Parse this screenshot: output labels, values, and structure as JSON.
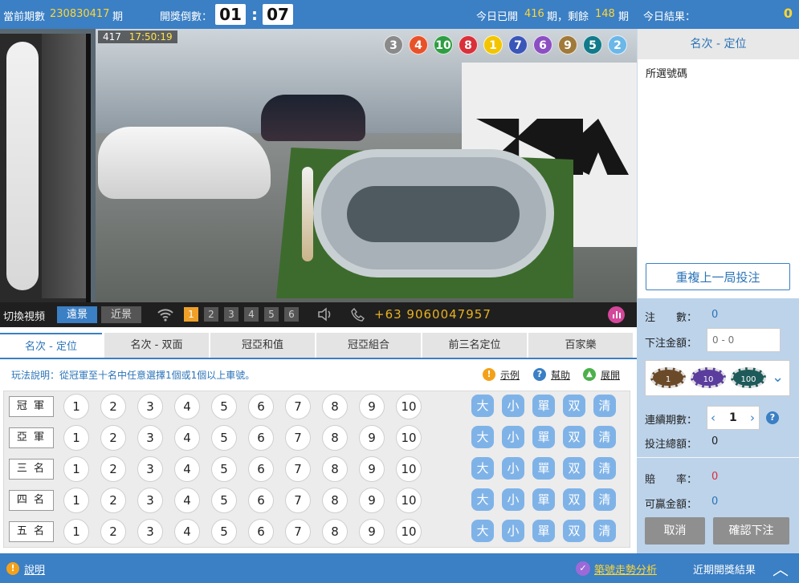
{
  "header": {
    "period_label": "當前期數",
    "period_value": "230830417",
    "period_unit": "期",
    "countdown_label": "開獎倒數：",
    "countdown_min": "01",
    "countdown_sep": ":",
    "countdown_sec": "07",
    "today_prefix": "今日已開",
    "today_opened": "416",
    "today_mid": "期，剩餘",
    "today_left": "148",
    "today_suffix": "期"
  },
  "video": {
    "overlay_period": "417",
    "overlay_time": "17:50:19",
    "result_balls": [
      {
        "n": "3",
        "color": "#8a8a8a"
      },
      {
        "n": "4",
        "color": "#e8522a"
      },
      {
        "n": "10",
        "color": "#2f9e43"
      },
      {
        "n": "8",
        "color": "#d9303a"
      },
      {
        "n": "1",
        "color": "#f3c500"
      },
      {
        "n": "7",
        "color": "#3a56b8"
      },
      {
        "n": "6",
        "color": "#8c4fc2"
      },
      {
        "n": "9",
        "color": "#a07a3a"
      },
      {
        "n": "5",
        "color": "#127a8a"
      },
      {
        "n": "2",
        "color": "#6bb7e8"
      }
    ]
  },
  "controls": {
    "switch_label": "切換視頻",
    "far_label": "遠景",
    "near_label": "近景",
    "cams": [
      "1",
      "2",
      "3",
      "4",
      "5",
      "6"
    ],
    "phone": "+63 9060047957"
  },
  "tabs": [
    "名次 - 定位",
    "名次 - 双面",
    "冠亞和值",
    "冠亞組合",
    "前三名定位",
    "百家樂"
  ],
  "rules": {
    "text": "玩法說明：從冠軍至十名中任意選擇1個或1個以上車號。",
    "example": "示例",
    "help": "幫助",
    "expand": "展開"
  },
  "rows": [
    "冠 軍",
    "亞 軍",
    "三 名",
    "四 名",
    "五 名"
  ],
  "numbers": [
    "1",
    "2",
    "3",
    "4",
    "5",
    "6",
    "7",
    "8",
    "9",
    "10"
  ],
  "quick": [
    "大",
    "小",
    "單",
    "双",
    "清"
  ],
  "right": {
    "today_results_label": "今日結果：",
    "today_results_value": "0",
    "mode_title": "名次 - 定位",
    "selected_label": "所選號碼",
    "repeat_button": "重複上一局投注",
    "bets_label": "注　　數：",
    "bets_value": "0",
    "amount_label": "下注金額：",
    "amount_placeholder": "0 - 0",
    "chips": [
      "1",
      "10",
      "100"
    ],
    "periods_label": "連續期數：",
    "periods_value": "1",
    "total_label": "投注總額：",
    "total_value": "0",
    "odds_label": "賠　　率：",
    "odds_value": "0",
    "win_label": "可贏金額：",
    "win_value": "0",
    "cancel": "取消",
    "confirm": "確認下注"
  },
  "footer": {
    "info": "說明",
    "trend": "築號走勢分析",
    "recent": "近期開獎結果"
  }
}
